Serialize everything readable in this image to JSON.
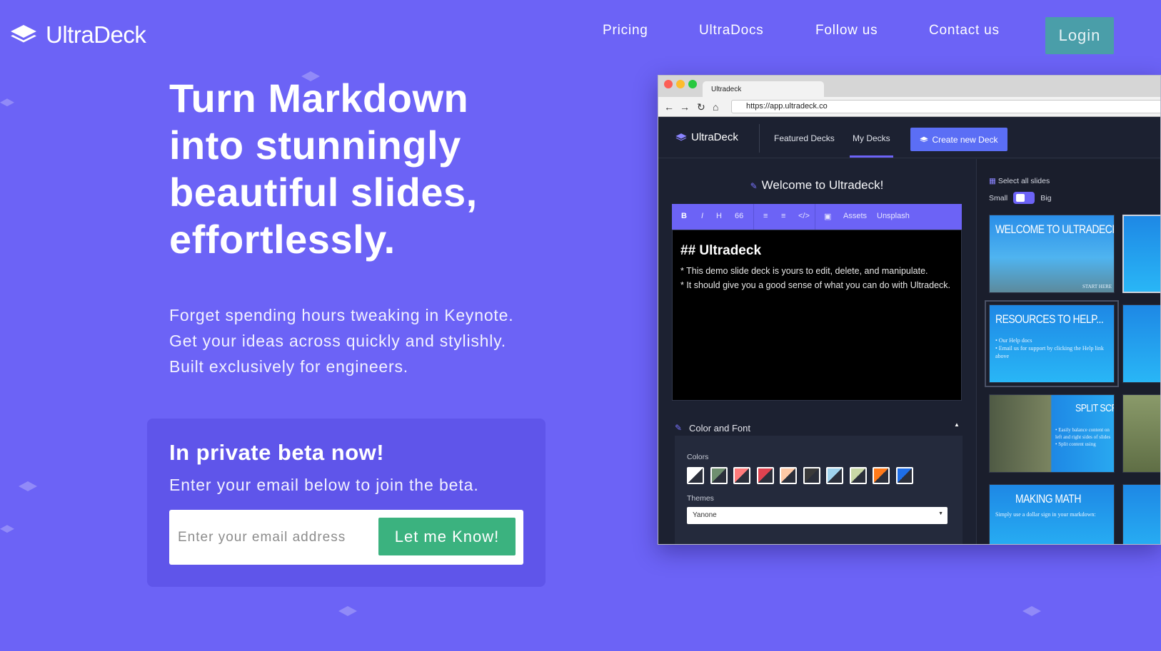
{
  "brand": {
    "name": "UltraDeck"
  },
  "nav": {
    "links": [
      "Pricing",
      "UltraDocs",
      "Follow us",
      "Contact us"
    ],
    "login": "Login"
  },
  "hero": {
    "headline_lines": [
      "Turn Markdown",
      "into stunningly",
      "beautiful slides,",
      "effortlessly."
    ],
    "subtext": "Forget spending hours tweaking in Keynote. Get your ideas across quickly and stylishly. Built exclusively for engineers."
  },
  "beta": {
    "title": "In private beta now!",
    "subtitle": "Enter your email below to join the beta.",
    "email_placeholder": "Enter your email address",
    "cta": "Let me Know!"
  },
  "screenshot": {
    "browser_tab": "Ultradeck",
    "url": "https://app.ultradeck.co",
    "app_brand": "UltraDeck",
    "nav_links": [
      "Featured Decks",
      "My Decks"
    ],
    "create_button": "Create new Deck",
    "editor_title": "Welcome to Ultradeck!",
    "toolbar": {
      "bold": "B",
      "italic": "I",
      "heading": "H",
      "quote": "66",
      "assets": "Assets",
      "unsplash": "Unsplash"
    },
    "markdown_heading": "## Ultradeck",
    "markdown_lines": [
      "* This demo slide deck is yours to edit, delete, and manipulate.",
      "* It should give you a good sense of what you can do with Ultradeck."
    ],
    "color_font_title": "Color and Font",
    "colors_label": "Colors",
    "themes_label": "Themes",
    "theme_value": "Yanone",
    "swatches": [
      "#ffffff",
      "#6f8f6f",
      "#ff7b7b",
      "#e0424f",
      "#ffc9a6",
      "#3a3a3a",
      "#9fd3ee",
      "#c9d8a6",
      "#ff7a1a",
      "#1e6ee8"
    ],
    "select_all": "Select all slides",
    "size_small": "Small",
    "size_big": "Big",
    "slides": [
      {
        "title": "WELCOME TO ULTRADECK!",
        "body": "START HERE"
      },
      {
        "title": "RESOURCES TO HELP...",
        "body": "• Our Help docs\n• Email us for support by clicking the Help link above"
      },
      {
        "title": "SPLIT SCREENS",
        "body": "• Easily balance content on left and right sides of slides\n• Split content using"
      },
      {
        "title": "MAKING MATH",
        "body": "Simply use a dollar sign in your markdown:"
      }
    ]
  },
  "colors": {
    "background": "#6c63f6",
    "login_button": "#4a9ea9",
    "cta_button": "#3bb27f",
    "beta_panel": "#5f55ea"
  }
}
